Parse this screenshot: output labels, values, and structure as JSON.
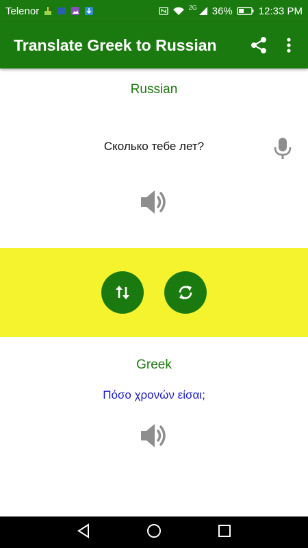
{
  "status_bar": {
    "carrier": "Telenor",
    "network": "2G",
    "battery": "36%",
    "time": "12:33 PM",
    "icons": [
      "cleaner-icon",
      "msg-icon",
      "gallery-icon",
      "download-icon",
      "nfc-icon",
      "wifi-icon",
      "signal-icon",
      "battery-icon"
    ]
  },
  "app_bar": {
    "title": "Translate Greek to Russian",
    "share_icon": "share-icon",
    "menu_icon": "more-vert-icon"
  },
  "source": {
    "language": "Russian",
    "text": "Сколько тебе лет?",
    "mic_icon": "mic-icon",
    "speaker_icon": "speaker-icon"
  },
  "controls": {
    "swap_icon": "swap-vert-icon",
    "refresh_icon": "refresh-icon",
    "band_color": "#f4f32e",
    "accent_color": "#1b7a0f"
  },
  "target": {
    "language": "Greek",
    "text": "Πόσο χρονών είσαι;",
    "speaker_icon": "speaker-icon"
  },
  "nav_bar": {
    "buttons": [
      "back-icon",
      "home-icon",
      "recents-icon"
    ]
  }
}
